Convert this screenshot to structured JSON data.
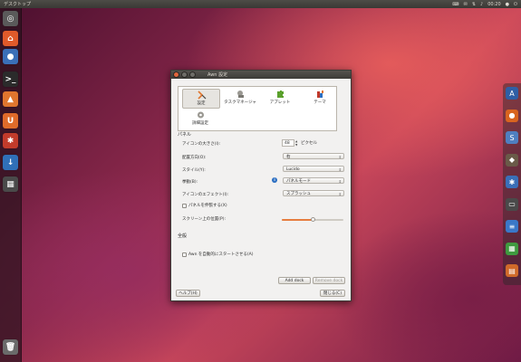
{
  "top_panel": {
    "title": "デスクトップ",
    "clock": "00:20",
    "icons": [
      "keyboard-icon",
      "mail-icon",
      "network-icon",
      "volume-icon",
      "user-icon",
      "power-icon"
    ]
  },
  "launcher": {
    "items": [
      {
        "name": "dash-home-icon",
        "glyph": "◎",
        "color": "#5a5a5a"
      },
      {
        "name": "home-folder-icon",
        "glyph": "⌂",
        "color": "#e05a2a"
      },
      {
        "name": "firefox-icon",
        "glyph": "●",
        "color": "#3a6fb8"
      },
      {
        "name": "terminal-icon",
        "glyph": ">_",
        "color": "#2b2b2b"
      },
      {
        "name": "software-center-icon",
        "glyph": "▲",
        "color": "#e0762e"
      },
      {
        "name": "ubuntu-one-icon",
        "glyph": "U",
        "color": "#e06b2a"
      },
      {
        "name": "settings-icon",
        "glyph": "✱",
        "color": "#c23b2b"
      },
      {
        "name": "update-manager-icon",
        "glyph": "↓",
        "color": "#3070b8"
      },
      {
        "name": "workspaces-icon",
        "glyph": "▦",
        "color": "#4a4a4a"
      },
      {
        "name": "trash-icon",
        "glyph": "🗑",
        "color": "#6a6a6a"
      }
    ]
  },
  "dock": {
    "items": [
      {
        "name": "awn-manager-icon",
        "glyph": "A",
        "color": "#2f5fa5"
      },
      {
        "name": "firefox-icon",
        "glyph": "●",
        "color": "#d8641f"
      },
      {
        "name": "dock-app-icon",
        "glyph": "S",
        "color": "#4f7fc0"
      },
      {
        "name": "gimp-icon",
        "glyph": "◆",
        "color": "#6a5a48"
      },
      {
        "name": "settings-icon",
        "glyph": "✱",
        "color": "#3a6fb8"
      },
      {
        "name": "monitor-icon",
        "glyph": "▭",
        "color": "#4a4a4a"
      },
      {
        "name": "writer-icon",
        "glyph": "≡",
        "color": "#3a78c8"
      },
      {
        "name": "calc-icon",
        "glyph": "▦",
        "color": "#3f9a3f"
      },
      {
        "name": "impress-icon",
        "glyph": "▤",
        "color": "#d06a2a"
      }
    ]
  },
  "window": {
    "title": "Awn 設定",
    "tabs": [
      {
        "label": "設定",
        "active": true
      },
      {
        "label": "タスクマネージャ",
        "active": false
      },
      {
        "label": "アプレット",
        "active": false
      },
      {
        "label": "テーマ",
        "active": false
      },
      {
        "label": "詳細設定",
        "active": false
      }
    ],
    "panel_section": "パネル",
    "icon_size_label": "アイコンの大きさ(I):",
    "icon_size_value": "48",
    "icon_size_unit": "ピクセル",
    "orientation_label": "配置方向(O):",
    "orientation_value": "右",
    "style_label": "スタイル(Y):",
    "style_value": "Lucido",
    "behavior_label": "挙動(B):",
    "behavior_value": "パネルモード",
    "effect_label": "アイコンのエフェクト(I):",
    "effect_value": "スプラッシュ",
    "expand_label": "パネルを伸張する(X)",
    "expand_checked": false,
    "position_label": "スクリーン上の位置(P):",
    "position_fraction": 0.5,
    "general_section": "全般",
    "autostart_label": "Awn を自動的にスタートさせる(A)",
    "autostart_checked": false,
    "add_dock_label": "Add dock",
    "remove_dock_label": "Remove dock",
    "help_label": "ヘルプ(H)",
    "close_label": "閉じる(C)",
    "accent_color": "#e67d3f"
  }
}
